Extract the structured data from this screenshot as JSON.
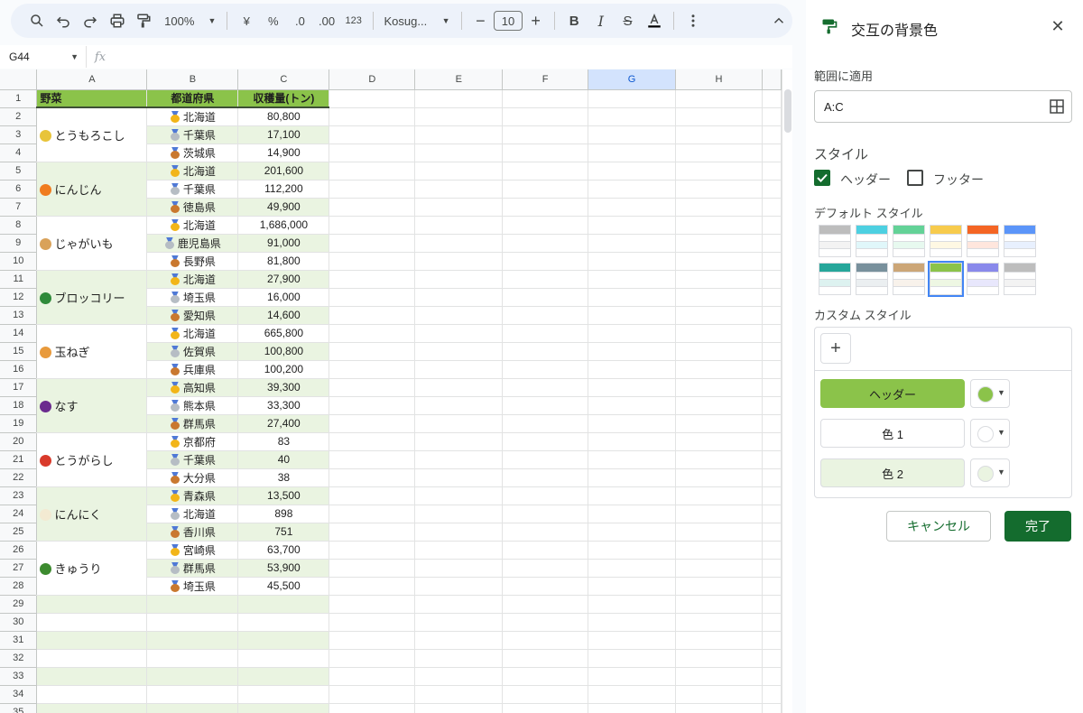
{
  "toolbar": {
    "zoom": "100%",
    "font_name": "Kosug...",
    "font_size": "10",
    "currency": "¥",
    "percent": "%",
    "dec_decrease": ".0",
    "dec_increase": ".00",
    "number_format": "123"
  },
  "name_box": "G44",
  "fx": "fx",
  "columns": [
    "A",
    "B",
    "C",
    "D",
    "E",
    "F",
    "G",
    "H"
  ],
  "selected_column": "G",
  "table": {
    "headers": [
      "野菜",
      "都道府県",
      "収穫量(トン)"
    ],
    "groups": [
      {
        "vegetable": "とうもろこし",
        "icon_color": "#e8c43a",
        "rows": [
          {
            "medal": "gold",
            "pref": "北海道",
            "amount": "80,800"
          },
          {
            "medal": "silver",
            "pref": "千葉県",
            "amount": "17,100"
          },
          {
            "medal": "bronze",
            "pref": "茨城県",
            "amount": "14,900"
          }
        ]
      },
      {
        "vegetable": "にんじん",
        "icon_color": "#f07c1e",
        "rows": [
          {
            "medal": "gold",
            "pref": "北海道",
            "amount": "201,600"
          },
          {
            "medal": "silver",
            "pref": "千葉県",
            "amount": "112,200"
          },
          {
            "medal": "bronze",
            "pref": "徳島県",
            "amount": "49,900"
          }
        ]
      },
      {
        "vegetable": "じゃがいも",
        "icon_color": "#d9a25a",
        "rows": [
          {
            "medal": "gold",
            "pref": "北海道",
            "amount": "1,686,000"
          },
          {
            "medal": "silver",
            "pref": "鹿児島県",
            "amount": "91,000"
          },
          {
            "medal": "bronze",
            "pref": "長野県",
            "amount": "81,800"
          }
        ]
      },
      {
        "vegetable": "ブロッコリー",
        "icon_color": "#2f8a3a",
        "rows": [
          {
            "medal": "gold",
            "pref": "北海道",
            "amount": "27,900"
          },
          {
            "medal": "silver",
            "pref": "埼玉県",
            "amount": "16,000"
          },
          {
            "medal": "bronze",
            "pref": "愛知県",
            "amount": "14,600"
          }
        ]
      },
      {
        "vegetable": "玉ねぎ",
        "icon_color": "#e89a3c",
        "rows": [
          {
            "medal": "gold",
            "pref": "北海道",
            "amount": "665,800"
          },
          {
            "medal": "silver",
            "pref": "佐賀県",
            "amount": "100,800"
          },
          {
            "medal": "bronze",
            "pref": "兵庫県",
            "amount": "100,200"
          }
        ]
      },
      {
        "vegetable": "なす",
        "icon_color": "#6b2b8e",
        "rows": [
          {
            "medal": "gold",
            "pref": "高知県",
            "amount": "39,300"
          },
          {
            "medal": "silver",
            "pref": "熊本県",
            "amount": "33,300"
          },
          {
            "medal": "bronze",
            "pref": "群馬県",
            "amount": "27,400"
          }
        ]
      },
      {
        "vegetable": "とうがらし",
        "icon_color": "#d93a2b",
        "rows": [
          {
            "medal": "gold",
            "pref": "京都府",
            "amount": "83"
          },
          {
            "medal": "silver",
            "pref": "千葉県",
            "amount": "40"
          },
          {
            "medal": "bronze",
            "pref": "大分県",
            "amount": "38"
          }
        ]
      },
      {
        "vegetable": "にんにく",
        "icon_color": "#f3ead2",
        "rows": [
          {
            "medal": "gold",
            "pref": "青森県",
            "amount": "13,500"
          },
          {
            "medal": "silver",
            "pref": "北海道",
            "amount": "898"
          },
          {
            "medal": "bronze",
            "pref": "香川県",
            "amount": "751"
          }
        ]
      },
      {
        "vegetable": "きゅうり",
        "icon_color": "#3d8b2f",
        "rows": [
          {
            "medal": "gold",
            "pref": "宮崎県",
            "amount": "63,700"
          },
          {
            "medal": "silver",
            "pref": "群馬県",
            "amount": "53,900"
          },
          {
            "medal": "bronze",
            "pref": "埼玉県",
            "amount": "45,500"
          }
        ]
      }
    ],
    "row_numbers_visible": 35
  },
  "panel": {
    "title": "交互の背景色",
    "range_label": "範囲に適用",
    "range_value": "A:C",
    "style_heading": "スタイル",
    "header_checkbox_label": "ヘッダー",
    "header_checked": true,
    "footer_checkbox_label": "フッター",
    "footer_checked": false,
    "default_styles_label": "デフォルト スタイル",
    "default_styles": [
      {
        "header": "#bdbdbd",
        "alt": "#f3f3f3"
      },
      {
        "header": "#4dd0e1",
        "alt": "#e0f7fa"
      },
      {
        "header": "#63d297",
        "alt": "#e7f9ef"
      },
      {
        "header": "#f7cb4d",
        "alt": "#fef8e3"
      },
      {
        "header": "#f46524",
        "alt": "#ffe6dd"
      },
      {
        "header": "#5b95f9",
        "alt": "#e8f0fe"
      },
      {
        "header": "#26a69a",
        "alt": "#ddf2f0"
      },
      {
        "header": "#78909c",
        "alt": "#ebeff1"
      },
      {
        "header": "#cca677",
        "alt": "#f8f2eb"
      },
      {
        "header": "#8bc34a",
        "alt": "#eef7e3"
      },
      {
        "header": "#8989eb",
        "alt": "#e8e7fc"
      },
      {
        "header": "#bdbdbd",
        "alt": "#f3f3f3"
      }
    ],
    "selected_style_index": 9,
    "custom_styles_label": "カスタム スタイル",
    "add_custom": "+",
    "custom_rows": [
      {
        "label": "ヘッダー",
        "bg": "#8bc34a",
        "swatch": "#8bc34a"
      },
      {
        "label": "色 1",
        "bg": "#ffffff",
        "swatch": "#ffffff"
      },
      {
        "label": "色 2",
        "bg": "#eaf4e1",
        "swatch": "#eaf4e1"
      }
    ],
    "cancel": "キャンセル",
    "done": "完了"
  },
  "colors": {
    "accent_green": "#146c2e",
    "header_green": "#8bc34a",
    "alt_green": "#eaf4e1"
  }
}
